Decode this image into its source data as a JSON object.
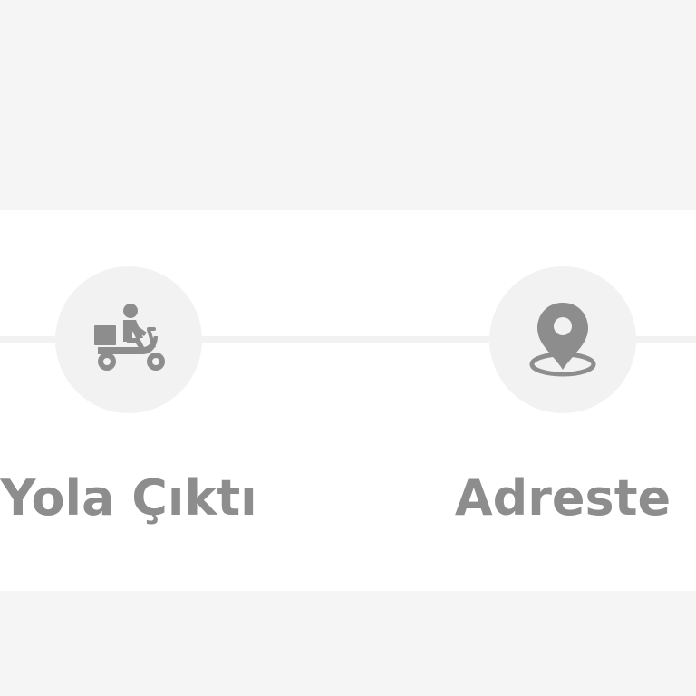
{
  "tracker": {
    "steps": [
      {
        "label": "Yola Çıktı",
        "icon": "scooter-courier-icon"
      },
      {
        "label": "Adreste",
        "icon": "location-pin-icon"
      }
    ]
  },
  "colors": {
    "background": "#f5f5f5",
    "card": "#ffffff",
    "circle": "#f2f2f2",
    "icon": "#8d8d8d",
    "label": "#8d8d8d"
  }
}
